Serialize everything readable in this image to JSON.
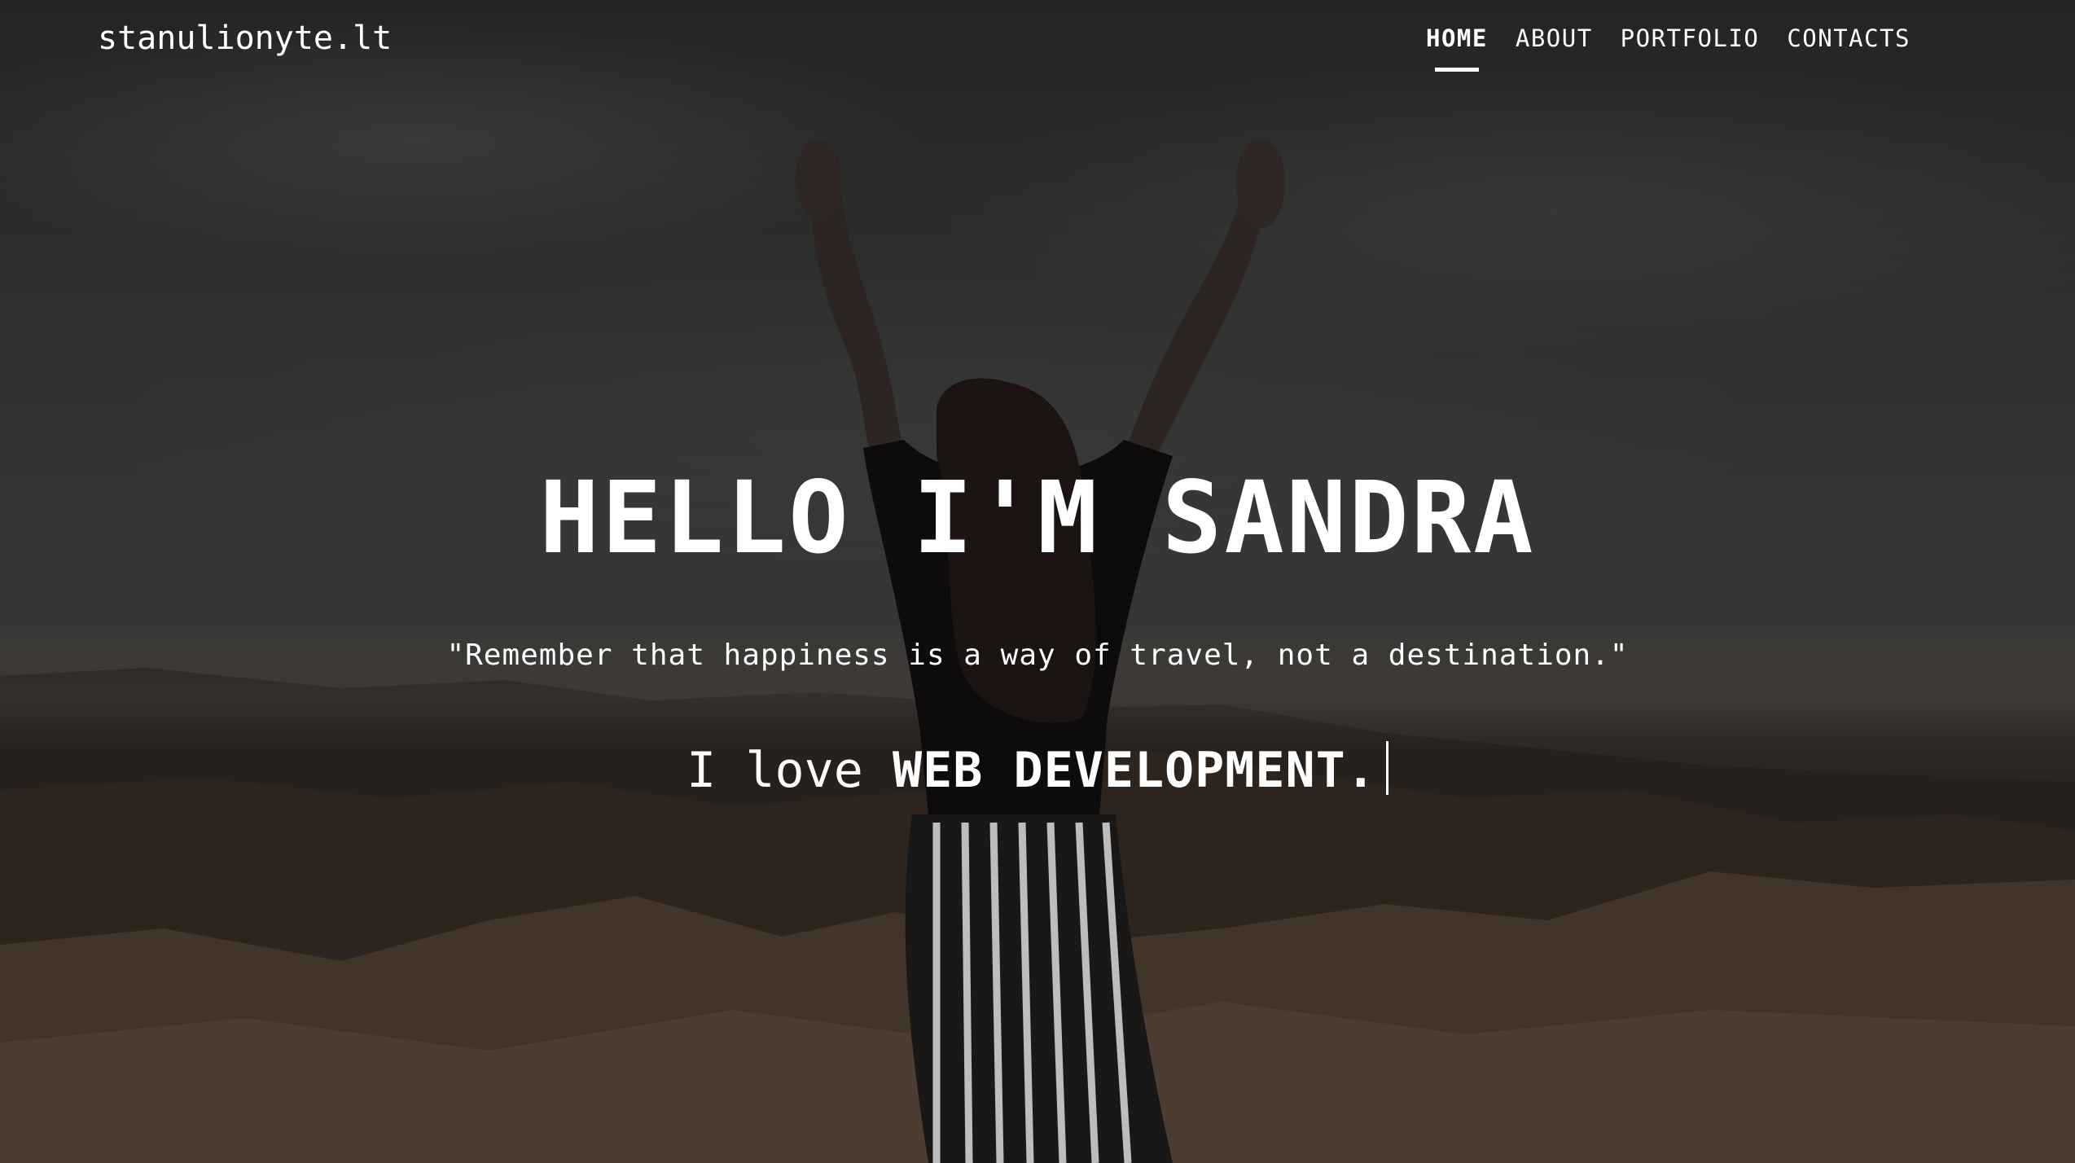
{
  "site": {
    "brand": "stanulionyte.lt"
  },
  "nav": {
    "items": [
      {
        "label": "HOME",
        "active": true
      },
      {
        "label": "ABOUT",
        "active": false
      },
      {
        "label": "PORTFOLIO",
        "active": false
      },
      {
        "label": "CONTACTS",
        "active": false
      }
    ]
  },
  "hero": {
    "headline": "HELLO I'M SANDRA",
    "quote": "\"Remember that happiness is a way of travel, not a destination.\"",
    "typing_prefix": "I love",
    "typing_word": "WEB DEVELOPMENT."
  },
  "colors": {
    "text": "#ffffff",
    "overlay": "rgba(0,0,0,0.38)"
  }
}
